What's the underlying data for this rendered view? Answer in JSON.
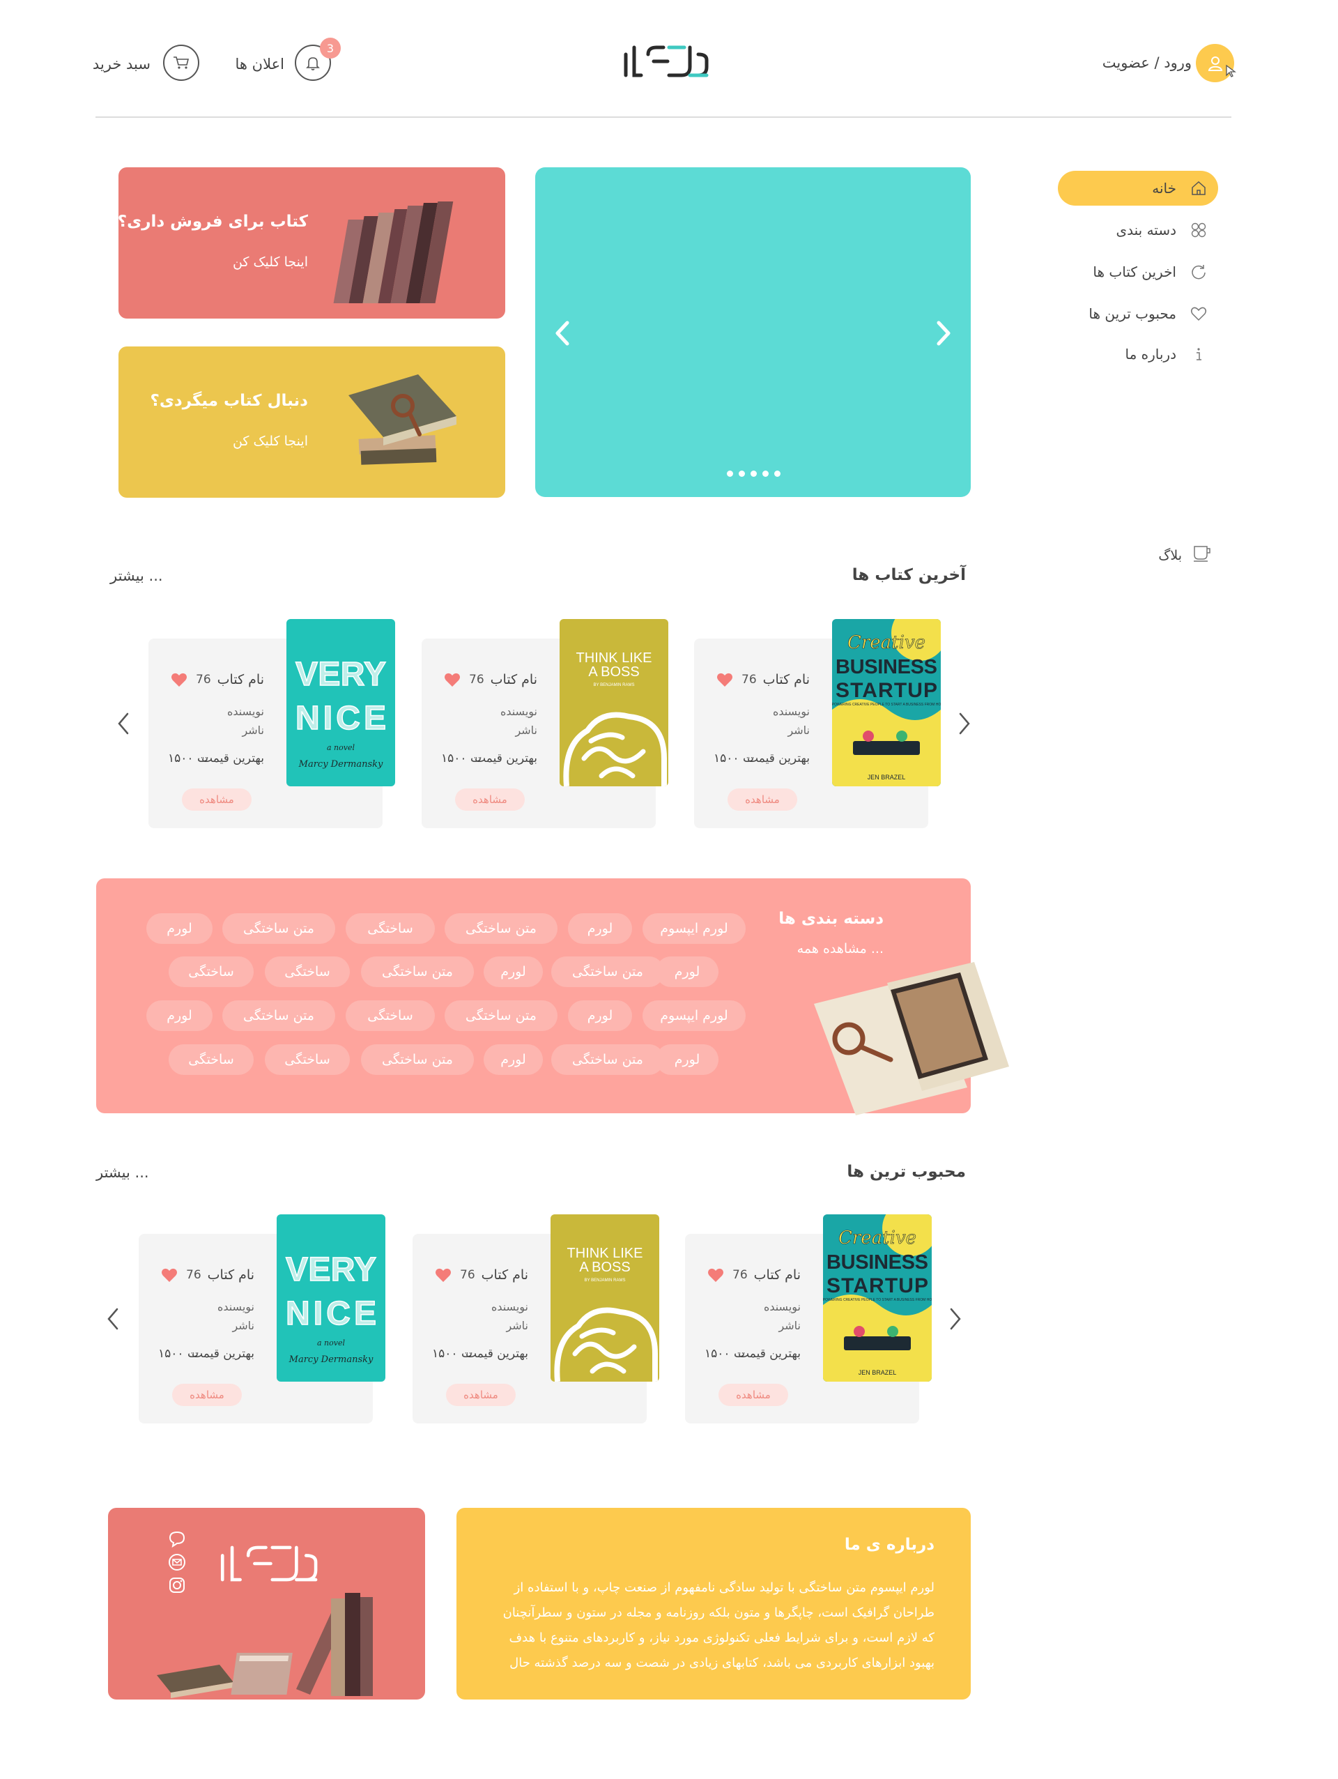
{
  "header": {
    "login_label": "ورود / عضویت",
    "notifications_label": "اعلان ها",
    "notifications_count": "3",
    "cart_label": "سبد خرید",
    "logo_text": "کتابی"
  },
  "nav": {
    "items": [
      {
        "label": "خانه",
        "icon": "home-icon",
        "active": true
      },
      {
        "label": "دسته بندی",
        "icon": "grid-icon"
      },
      {
        "label": "اخرین کتاب ها",
        "icon": "refresh-icon"
      },
      {
        "label": "محبوب ترین ها",
        "icon": "heart-icon"
      },
      {
        "label": "درباره ما",
        "icon": "info-icon"
      }
    ],
    "blog_label": "بلاگ"
  },
  "promos": [
    {
      "title": "کتاب برای فروش داری؟",
      "subtitle": "اینجا کلیک کن",
      "color": "#ea7b74"
    },
    {
      "title": "دنبال کتاب میگردی؟",
      "subtitle": "اینجا کلیک کن",
      "color": "#ecc64e"
    }
  ],
  "slider": {
    "color": "#5cdbd5",
    "dots": 5
  },
  "latest": {
    "title": "آخرین کتاب ها",
    "more": "بیشتر ...",
    "books": [
      {
        "name": "نام کتاب",
        "likes": "76",
        "author": "نویسنده",
        "publisher": "ناشر",
        "price_label": "بهترین قیمت",
        "price": "۱۵۰۰ ت",
        "view": "مشاهده",
        "cover": "creative"
      },
      {
        "name": "نام کتاب",
        "likes": "76",
        "author": "نویسنده",
        "publisher": "ناشر",
        "price_label": "بهترین قیمت",
        "price": "۱۵۰۰ ت",
        "view": "مشاهده",
        "cover": "think"
      },
      {
        "name": "نام کتاب",
        "likes": "76",
        "author": "نویسنده",
        "publisher": "ناشر",
        "price_label": "بهترین قیمت",
        "price": "۱۵۰۰ ت",
        "view": "مشاهده",
        "cover": "verynice"
      }
    ]
  },
  "categories": {
    "title": "دسته بندی ها",
    "view_all": "مشاهده همه ...",
    "rows": [
      [
        "لورم ایپسوم",
        "لورم",
        "متن ساختگی",
        "ساختگی",
        "متن ساختگی",
        "لورم"
      ],
      [
        "لورم",
        "متن ساختگی",
        "لورم",
        "متن ساختگی",
        "ساختگی",
        "ساختگی"
      ],
      [
        "لورم ایپسوم",
        "لورم",
        "متن ساختگی",
        "ساختگی",
        "متن ساختگی",
        "لورم"
      ],
      [
        "لورم",
        "متن ساختگی",
        "لورم",
        "متن ساختگی",
        "ساختگی",
        "ساختگی"
      ]
    ]
  },
  "popular": {
    "title": "محبوب ترین ها",
    "more": "بیشتر ...",
    "books": [
      {
        "name": "نام کتاب",
        "likes": "76",
        "author": "نویسنده",
        "publisher": "ناشر",
        "price_label": "بهترین قیمت",
        "price": "۱۵۰۰ ت",
        "view": "مشاهده",
        "cover": "creative"
      },
      {
        "name": "نام کتاب",
        "likes": "76",
        "author": "نویسنده",
        "publisher": "ناشر",
        "price_label": "بهترین قیمت",
        "price": "۱۵۰۰ ت",
        "view": "مشاهده",
        "cover": "think"
      },
      {
        "name": "نام کتاب",
        "likes": "76",
        "author": "نویسنده",
        "publisher": "ناشر",
        "price_label": "بهترین قیمت",
        "price": "۱۵۰۰ ت",
        "view": "مشاهده",
        "cover": "verynice"
      }
    ]
  },
  "covers": {
    "creative": {
      "line1": "Creative",
      "line2": "BUSINESS",
      "line3": "STARTUP",
      "tagline": "EMPOWERING CREATIVE PEOPLE TO START A BUSINESS FROM HOME",
      "author": "JEN BRAZEL"
    },
    "think": {
      "line1": "THINK LIKE",
      "line2": "A BOSS",
      "byline": "BY BENJAMIN RAMS"
    },
    "verynice": {
      "line1": "VERY",
      "line2": "NICE",
      "sub": "a novel",
      "author": "Marcy Dermansky"
    }
  },
  "about": {
    "title": "درباره ی ما",
    "text": "لورم ایپسوم متن ساختگی با تولید سادگی نامفهوم از صنعت چاپ، و با استفاده از طراحان گرافیک است، چاپگرها و متون بلکه روزنامه و مجله در ستون و سطرآنچنان که لازم است، و برای شرایط فعلی تکنولوژی مورد نیاز، و کاربردهای متنوع با هدف بهبود ابزارهای کاربردی می باشد، کتابهای زیادی در شصت و سه درصد گذشته حال"
  },
  "footer": {
    "logo_text": "کتابی",
    "social": [
      "chat-icon",
      "mail-icon",
      "instagram-icon"
    ]
  }
}
